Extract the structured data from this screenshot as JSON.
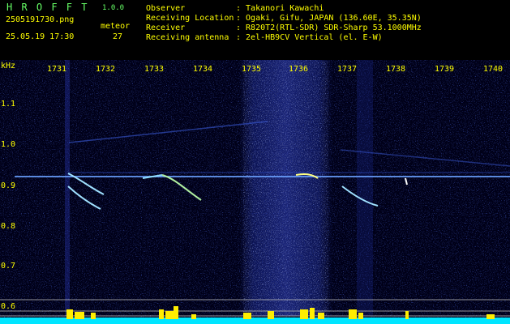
{
  "header": {
    "app_name": "H R O F F T",
    "version": "1.0.0",
    "filename": "2505191730.png",
    "datetime": "25.05.19 17:30",
    "meteor_label": "meteor",
    "meteor_count": "27",
    "info": [
      {
        "label": "Observer",
        "value": ": Takanori Kawachi"
      },
      {
        "label": "Receiving Location",
        "value": ": Ogaki, Gifu, JAPAN (136.60E, 35.35N)"
      },
      {
        "label": "Receiver",
        "value": ": R820T2(RTL-SDR) SDR-Sharp 53.1000MHz"
      },
      {
        "label": "Receiving antenna",
        "value": ": 2el-HB9CV Vertical (el. E-W)"
      }
    ]
  },
  "axis": {
    "y_unit": "kHz",
    "x_ticks": [
      "1731",
      "1732",
      "1733",
      "1734",
      "1735",
      "1736",
      "1737",
      "1738",
      "1739",
      "1740"
    ],
    "y_ticks": [
      "1.1",
      "1.0",
      "0.9",
      "0.8",
      "0.7",
      "0.6"
    ]
  },
  "colors": {
    "background": "#000000",
    "header_text": "#ffff00",
    "signal": "#6aa0ff",
    "baseline": "#00e5ff"
  }
}
